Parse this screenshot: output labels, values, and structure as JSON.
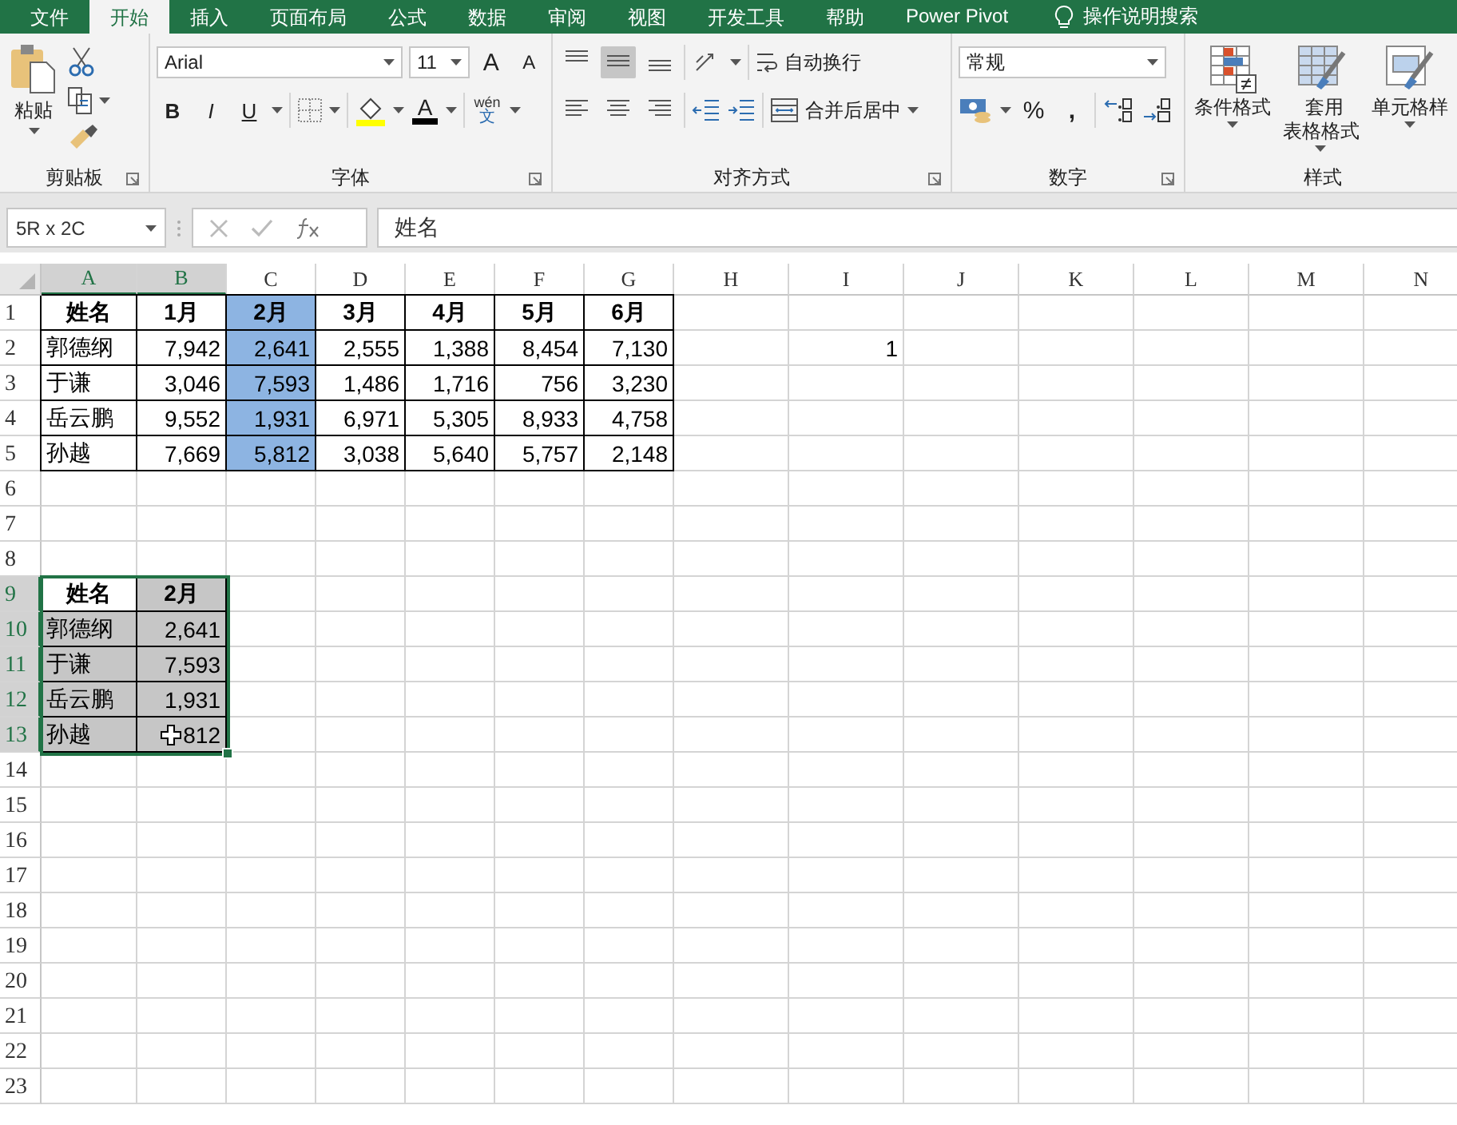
{
  "tabs": [
    {
      "label": "文件",
      "selected": false
    },
    {
      "label": "开始",
      "selected": true
    },
    {
      "label": "插入",
      "selected": false
    },
    {
      "label": "页面布局",
      "selected": false
    },
    {
      "label": "公式",
      "selected": false
    },
    {
      "label": "数据",
      "selected": false
    },
    {
      "label": "审阅",
      "selected": false
    },
    {
      "label": "视图",
      "selected": false
    },
    {
      "label": "开发工具",
      "selected": false
    },
    {
      "label": "帮助",
      "selected": false
    },
    {
      "label": "Power Pivot",
      "selected": false
    }
  ],
  "tell_me": {
    "placeholder": "操作说明搜索"
  },
  "clipboard": {
    "paste_label": "粘贴",
    "group_label": "剪贴板"
  },
  "font": {
    "family": "Arial",
    "size": "11",
    "grow_label": "A",
    "shrink_label": "A",
    "styles": [
      {
        "label": "B",
        "kind": "bold"
      },
      {
        "label": "I",
        "kind": "italic"
      },
      {
        "label": "U",
        "kind": "underline"
      }
    ],
    "color_label": "A",
    "phonetic_top": "wén",
    "phonetic_bottom": "文",
    "group_label": "字体"
  },
  "alignment": {
    "vertical": [
      {
        "kind": "top",
        "selected": false
      },
      {
        "kind": "middle",
        "selected": true
      },
      {
        "kind": "bottom",
        "selected": false
      }
    ],
    "horizontal": [
      {
        "kind": "left",
        "selected": false
      },
      {
        "kind": "center",
        "selected": false
      },
      {
        "kind": "right",
        "selected": false
      }
    ],
    "wrap_label": "自动换行",
    "merge_label": "合并后居中",
    "group_label": "对齐方式"
  },
  "number": {
    "format": "常规",
    "percent_label": "%",
    "comma_label": ",",
    "group_label": "数字"
  },
  "styles": {
    "buttons": [
      {
        "label": "条件格式",
        "kind": "conditional"
      },
      {
        "label": "套用表格格式",
        "kind": "table"
      },
      {
        "label": "单元格样",
        "kind": "cell"
      }
    ],
    "group_label": "样式"
  },
  "formula_bar": {
    "name_box": "5R x 2C",
    "formula": "姓名"
  },
  "columns": [
    {
      "label": "A",
      "selected": true
    },
    {
      "label": "B",
      "selected": true
    },
    {
      "label": "C",
      "selected": false
    },
    {
      "label": "D",
      "selected": false
    },
    {
      "label": "E",
      "selected": false
    },
    {
      "label": "F",
      "selected": false
    },
    {
      "label": "G",
      "selected": false
    },
    {
      "label": "H",
      "selected": false
    },
    {
      "label": "I",
      "selected": false
    },
    {
      "label": "J",
      "selected": false
    },
    {
      "label": "K",
      "selected": false
    },
    {
      "label": "L",
      "selected": false
    },
    {
      "label": "M",
      "selected": false
    },
    {
      "label": "N",
      "selected": false
    }
  ],
  "rows": [
    {
      "label": "1",
      "selected": false,
      "cells": [
        {
          "text": "姓名",
          "kind": "header",
          "bordered": true,
          "selected": false
        },
        {
          "text": "1月",
          "kind": "header",
          "bordered": true,
          "selected": false
        },
        {
          "text": "2月",
          "kind": "header",
          "bordered": true,
          "selected": false,
          "color": "#8db4e2"
        },
        {
          "text": "3月",
          "kind": "header",
          "bordered": true,
          "selected": false
        },
        {
          "text": "4月",
          "kind": "header",
          "bordered": true,
          "selected": false
        },
        {
          "text": "5月",
          "kind": "header",
          "bordered": true,
          "selected": false
        },
        {
          "text": "6月",
          "kind": "header",
          "bordered": true,
          "selected": false
        }
      ]
    },
    {
      "label": "2",
      "selected": false,
      "cells": [
        {
          "text": "郭德纲",
          "kind": "text",
          "bordered": true,
          "selected": false
        },
        {
          "text": "7,942",
          "kind": "number",
          "bordered": true,
          "selected": false
        },
        {
          "text": "2,641",
          "kind": "number",
          "bordered": true,
          "selected": false,
          "color": "#8db4e2"
        },
        {
          "text": "2,555",
          "kind": "number",
          "bordered": true,
          "selected": false
        },
        {
          "text": "1,388",
          "kind": "number",
          "bordered": true,
          "selected": false
        },
        {
          "text": "8,454",
          "kind": "number",
          "bordered": true,
          "selected": false
        },
        {
          "text": "7,130",
          "kind": "number",
          "bordered": true,
          "selected": false
        },
        {},
        {
          "text": "1",
          "kind": "number",
          "bordered": false,
          "selected": false
        }
      ]
    },
    {
      "label": "3",
      "selected": false,
      "cells": [
        {
          "text": "于谦",
          "kind": "text",
          "bordered": true,
          "selected": false
        },
        {
          "text": "3,046",
          "kind": "number",
          "bordered": true,
          "selected": false
        },
        {
          "text": "7,593",
          "kind": "number",
          "bordered": true,
          "selected": false,
          "color": "#8db4e2"
        },
        {
          "text": "1,486",
          "kind": "number",
          "bordered": true,
          "selected": false
        },
        {
          "text": "1,716",
          "kind": "number",
          "bordered": true,
          "selected": false
        },
        {
          "text": "756",
          "kind": "number",
          "bordered": true,
          "selected": false
        },
        {
          "text": "3,230",
          "kind": "number",
          "bordered": true,
          "selected": false
        }
      ]
    },
    {
      "label": "4",
      "selected": false,
      "cells": [
        {
          "text": "岳云鹏",
          "kind": "text",
          "bordered": true,
          "selected": false
        },
        {
          "text": "9,552",
          "kind": "number",
          "bordered": true,
          "selected": false
        },
        {
          "text": "1,931",
          "kind": "number",
          "bordered": true,
          "selected": false,
          "color": "#8db4e2"
        },
        {
          "text": "6,971",
          "kind": "number",
          "bordered": true,
          "selected": false
        },
        {
          "text": "5,305",
          "kind": "number",
          "bordered": true,
          "selected": false
        },
        {
          "text": "8,933",
          "kind": "number",
          "bordered": true,
          "selected": false
        },
        {
          "text": "4,758",
          "kind": "number",
          "bordered": true,
          "selected": false
        }
      ]
    },
    {
      "label": "5",
      "selected": false,
      "cells": [
        {
          "text": "孙越",
          "kind": "text",
          "bordered": true,
          "selected": false
        },
        {
          "text": "7,669",
          "kind": "number",
          "bordered": true,
          "selected": false
        },
        {
          "text": "5,812",
          "kind": "number",
          "bordered": true,
          "selected": false,
          "color": "#8db4e2"
        },
        {
          "text": "3,038",
          "kind": "number",
          "bordered": true,
          "selected": false
        },
        {
          "text": "5,640",
          "kind": "number",
          "bordered": true,
          "selected": false
        },
        {
          "text": "5,757",
          "kind": "number",
          "bordered": true,
          "selected": false
        },
        {
          "text": "2,148",
          "kind": "number",
          "bordered": true,
          "selected": false
        }
      ]
    },
    {
      "label": "6",
      "selected": false,
      "cells": []
    },
    {
      "label": "7",
      "selected": false,
      "cells": []
    },
    {
      "label": "8",
      "selected": false,
      "cells": []
    },
    {
      "label": "9",
      "selected": true,
      "cells": [
        {
          "text": "姓名",
          "kind": "header",
          "bordered": true,
          "selected": true,
          "active": true
        },
        {
          "text": "2月",
          "kind": "header",
          "bordered": true,
          "selected": true,
          "active": false
        }
      ]
    },
    {
      "label": "10",
      "selected": true,
      "cells": [
        {
          "text": "郭德纲",
          "kind": "text",
          "bordered": true,
          "selected": true,
          "active": false
        },
        {
          "text": "2,641",
          "kind": "number",
          "bordered": true,
          "selected": true,
          "active": false
        }
      ]
    },
    {
      "label": "11",
      "selected": true,
      "cells": [
        {
          "text": "于谦",
          "kind": "text",
          "bordered": true,
          "selected": true,
          "active": false
        },
        {
          "text": "7,593",
          "kind": "number",
          "bordered": true,
          "selected": true,
          "active": false
        }
      ]
    },
    {
      "label": "12",
      "selected": true,
      "cells": [
        {
          "text": "岳云鹏",
          "kind": "text",
          "bordered": true,
          "selected": true,
          "active": false
        },
        {
          "text": "1,931",
          "kind": "number",
          "bordered": true,
          "selected": true,
          "active": false
        }
      ]
    },
    {
      "label": "13",
      "selected": true,
      "cells": [
        {
          "text": "孙越",
          "kind": "text",
          "bordered": true,
          "selected": true,
          "active": false
        },
        {
          "text": "812",
          "kind": "number",
          "bordered": true,
          "selected": true,
          "active": false,
          "cursor": true
        }
      ]
    },
    {
      "label": "14",
      "selected": false,
      "cells": []
    },
    {
      "label": "15",
      "selected": false,
      "cells": []
    },
    {
      "label": "16",
      "selected": false,
      "cells": []
    },
    {
      "label": "17",
      "selected": false,
      "cells": []
    },
    {
      "label": "18",
      "selected": false,
      "cells": []
    },
    {
      "label": "19",
      "selected": false,
      "cells": []
    },
    {
      "label": "20",
      "selected": false,
      "cells": []
    },
    {
      "label": "21",
      "selected": false,
      "cells": []
    },
    {
      "label": "22",
      "selected": false,
      "cells": []
    },
    {
      "label": "23",
      "selected": false,
      "cells": []
    }
  ]
}
